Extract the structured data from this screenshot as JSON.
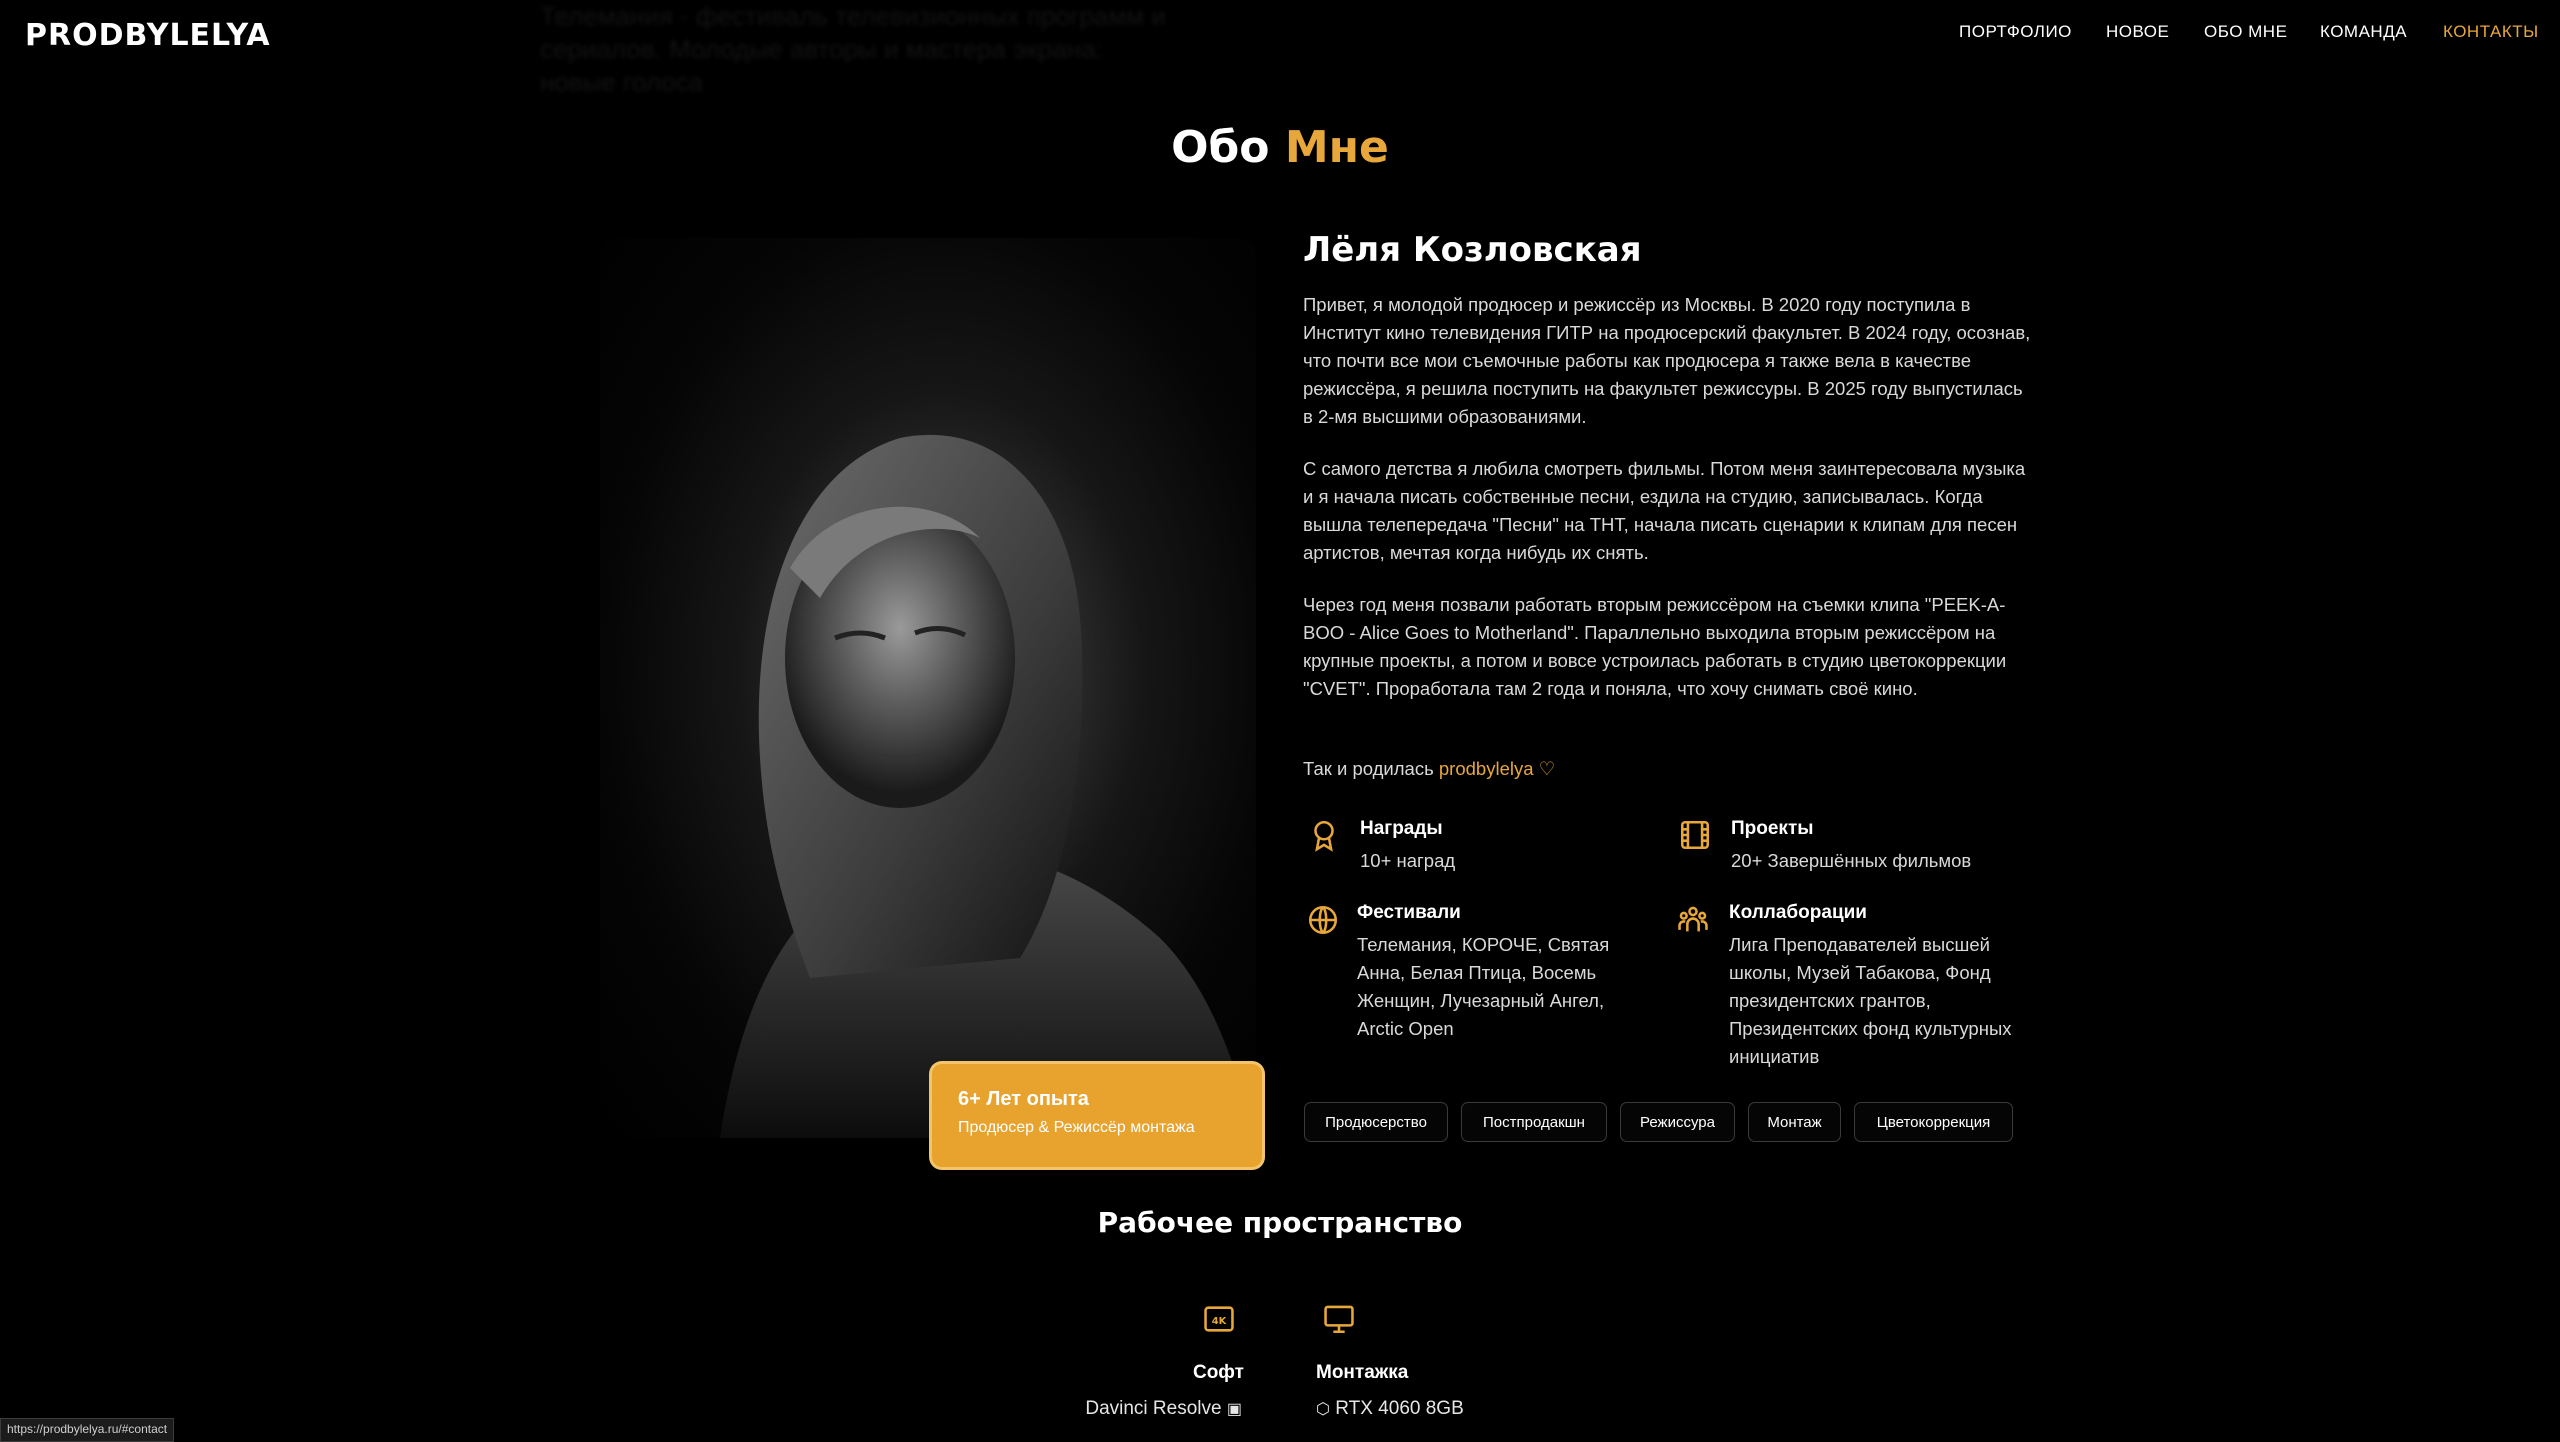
{
  "header": {
    "logo": "PRODBYLELYA",
    "nav": [
      "ПОРТФОЛИО",
      "НОВОЕ",
      "ОБО МНЕ",
      "КОМАНДА",
      "КОНТАКТЫ"
    ],
    "ghost_text": "Телемания - фестиваль телевизионных программ и сериалов. Молодые авторы и мастера экрана: новые голоса"
  },
  "about": {
    "title_part1": "Обо",
    "title_part2": "Мне",
    "name": "Лёля Козловская",
    "paragraphs": [
      "Привет, я молодой продюсер и режиссёр из Москвы. В 2020 году поступила в Институт кино телевидения ГИТР на продюсерский факультет. В 2024 году, осознав, что почти все мои съемочные работы как продюсера я также вела в качестве режиссёра, я решила поступить на факультет режиссуры. В 2025 году выпустилась в 2-мя высшими образованиями.",
      "С самого детства я любила смотреть фильмы. Потом меня заинтересовала музыка и я начала писать собственные песни, ездила на студию, записывалась. Когда вышла телепередача \"Песни\" на ТНТ, начала писать сценарии к клипам для песен артистов, мечтая когда нибудь их снять.",
      "Через год меня позвали работать вторым режиссёром на съемки клипа \"PEEK-A-BOO - Alice Goes to Motherland\". Параллельно выходила вторым режиссёром на крупные проекты, а потом и вовсе устроилась работать в студию цветокоррекции \"CVET\". Проработала там 2 года и поняла, что хочу снимать своё кино."
    ],
    "born_text": "Так и родилась",
    "born_link": "prodbylelya",
    "stats": {
      "awards": {
        "title": "Награды",
        "text": "10+ наград"
      },
      "projects": {
        "title": "Проекты",
        "text": "20+ Завершённых фильмов"
      },
      "festivals": {
        "title": "Фестивали",
        "text": "Телемания, КОРОЧЕ, Святая Анна, Белая Птица, Восемь Женщин, Лучезарный Ангел, Arctic Open"
      },
      "collabs": {
        "title": "Коллаборации",
        "text": "Лига Преподавателей высшей школы, Музей Табакова, Фонд президентских грантов, Президентских фонд культурных инициатив"
      }
    },
    "tags": [
      "Продюсерство",
      "Постпродакшн",
      "Режиссура",
      "Монтаж",
      "Цветокоррекция"
    ],
    "experience": {
      "title": "6+ Лет опыта",
      "subtitle": "Продюсер & Режиссёр монтажа"
    }
  },
  "workspace": {
    "title": "Рабочее пространство",
    "soft": {
      "title": "Софт",
      "items": [
        "Davinci Resolve"
      ]
    },
    "montage": {
      "title": "Монтажка",
      "items": [
        "RTX 4060 8GB"
      ]
    }
  },
  "statusbar": "https://prodbylelya.ru/#contact",
  "colors": {
    "accent": "#e8a73a",
    "background": "#000000"
  }
}
